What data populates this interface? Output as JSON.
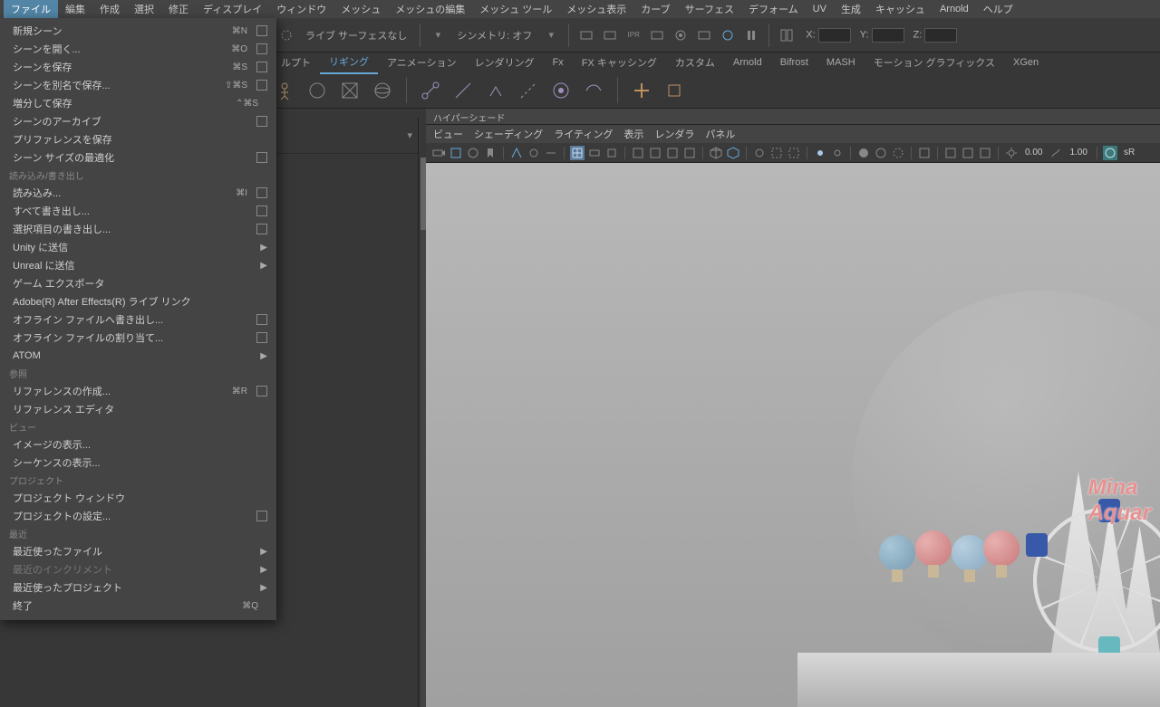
{
  "menubar": [
    "ファイル",
    "編集",
    "作成",
    "選択",
    "修正",
    "ディスプレイ",
    "ウィンドウ",
    "メッシュ",
    "メッシュの編集",
    "メッシュ ツール",
    "メッシュ表示",
    "カーブ",
    "サーフェス",
    "デフォーム",
    "UV",
    "生成",
    "キャッシュ",
    "Arnold",
    "ヘルプ"
  ],
  "menubar_active_index": 0,
  "toolbar": {
    "live_label": "ライブ サーフェスなし",
    "symmetry_label": "シンメトリ: オフ",
    "coords": {
      "x": "X:",
      "y": "Y:",
      "z": "Z:"
    }
  },
  "shelf_tabs": [
    "ルプト",
    "リギング",
    "アニメーション",
    "レンダリング",
    "Fx",
    "FX キャッシング",
    "カスタム",
    "Arnold",
    "Bifrost",
    "MASH",
    "モーション グラフィックス",
    "XGen"
  ],
  "shelf_active_index": 1,
  "hypershade_label": "ハイパーシェード",
  "panel_menu": [
    "ビュー",
    "シェーディング",
    "ライティング",
    "表示",
    "レンダラ",
    "パネル"
  ],
  "panel_values": {
    "left": "0.00",
    "right": "1.00",
    "space": "sR"
  },
  "scene_text": {
    "line1": "Mina",
    "line2": "Aquar"
  },
  "file_menu": {
    "groups": [
      {
        "items": [
          {
            "label": "新規シーン",
            "shortcut": "⌘N",
            "optbox": true
          },
          {
            "label": "シーンを開く...",
            "shortcut": "⌘O",
            "optbox": true
          }
        ]
      },
      {
        "items": [
          {
            "label": "シーンを保存",
            "shortcut": "⌘S",
            "optbox": true
          },
          {
            "label": "シーンを別名で保存...",
            "shortcut": "⇧⌘S",
            "optbox": true
          },
          {
            "label": "増分して保存",
            "shortcut": "⌃⌘S"
          },
          {
            "label": "シーンのアーカイブ",
            "optbox": true
          },
          {
            "label": "プリファレンスを保存"
          }
        ]
      },
      {
        "items": [
          {
            "label": "シーン サイズの最適化",
            "optbox": true
          }
        ]
      },
      {
        "header": "読み込み/書き出し",
        "items": [
          {
            "label": "読み込み...",
            "shortcut": "⌘I",
            "optbox": true
          },
          {
            "label": "すべて書き出し...",
            "optbox": true
          },
          {
            "label": "選択項目の書き出し...",
            "optbox": true
          }
        ]
      },
      {
        "items": [
          {
            "label": "Unity に送信",
            "submenu": true
          },
          {
            "label": "Unreal に送信",
            "submenu": true
          }
        ]
      },
      {
        "items": [
          {
            "label": "ゲーム エクスポータ"
          }
        ]
      },
      {
        "items": [
          {
            "label": "Adobe(R) After Effects(R) ライブ リンク"
          }
        ]
      },
      {
        "items": [
          {
            "label": "オフライン ファイルへ書き出し...",
            "optbox": true
          },
          {
            "label": "オフライン ファイルの割り当て...",
            "optbox": true
          }
        ]
      },
      {
        "items": [
          {
            "label": "ATOM",
            "submenu": true
          }
        ]
      },
      {
        "header": "参照",
        "items": [
          {
            "label": "リファレンスの作成...",
            "shortcut": "⌘R",
            "optbox": true
          },
          {
            "label": "リファレンス エディタ"
          }
        ]
      },
      {
        "header": "ビュー",
        "items": [
          {
            "label": "イメージの表示..."
          },
          {
            "label": "シーケンスの表示..."
          }
        ]
      },
      {
        "header": "プロジェクト",
        "items": [
          {
            "label": "プロジェクト ウィンドウ"
          },
          {
            "label": "プロジェクトの設定...",
            "optbox": true
          }
        ]
      },
      {
        "header": "最近",
        "items": [
          {
            "label": "最近使ったファイル",
            "submenu": true
          },
          {
            "label": "最近のインクリメント",
            "submenu": true,
            "disabled": true
          },
          {
            "label": "最近使ったプロジェクト",
            "submenu": true
          }
        ]
      },
      {
        "items": [
          {
            "label": "終了",
            "shortcut": "⌘Q"
          }
        ]
      }
    ]
  }
}
